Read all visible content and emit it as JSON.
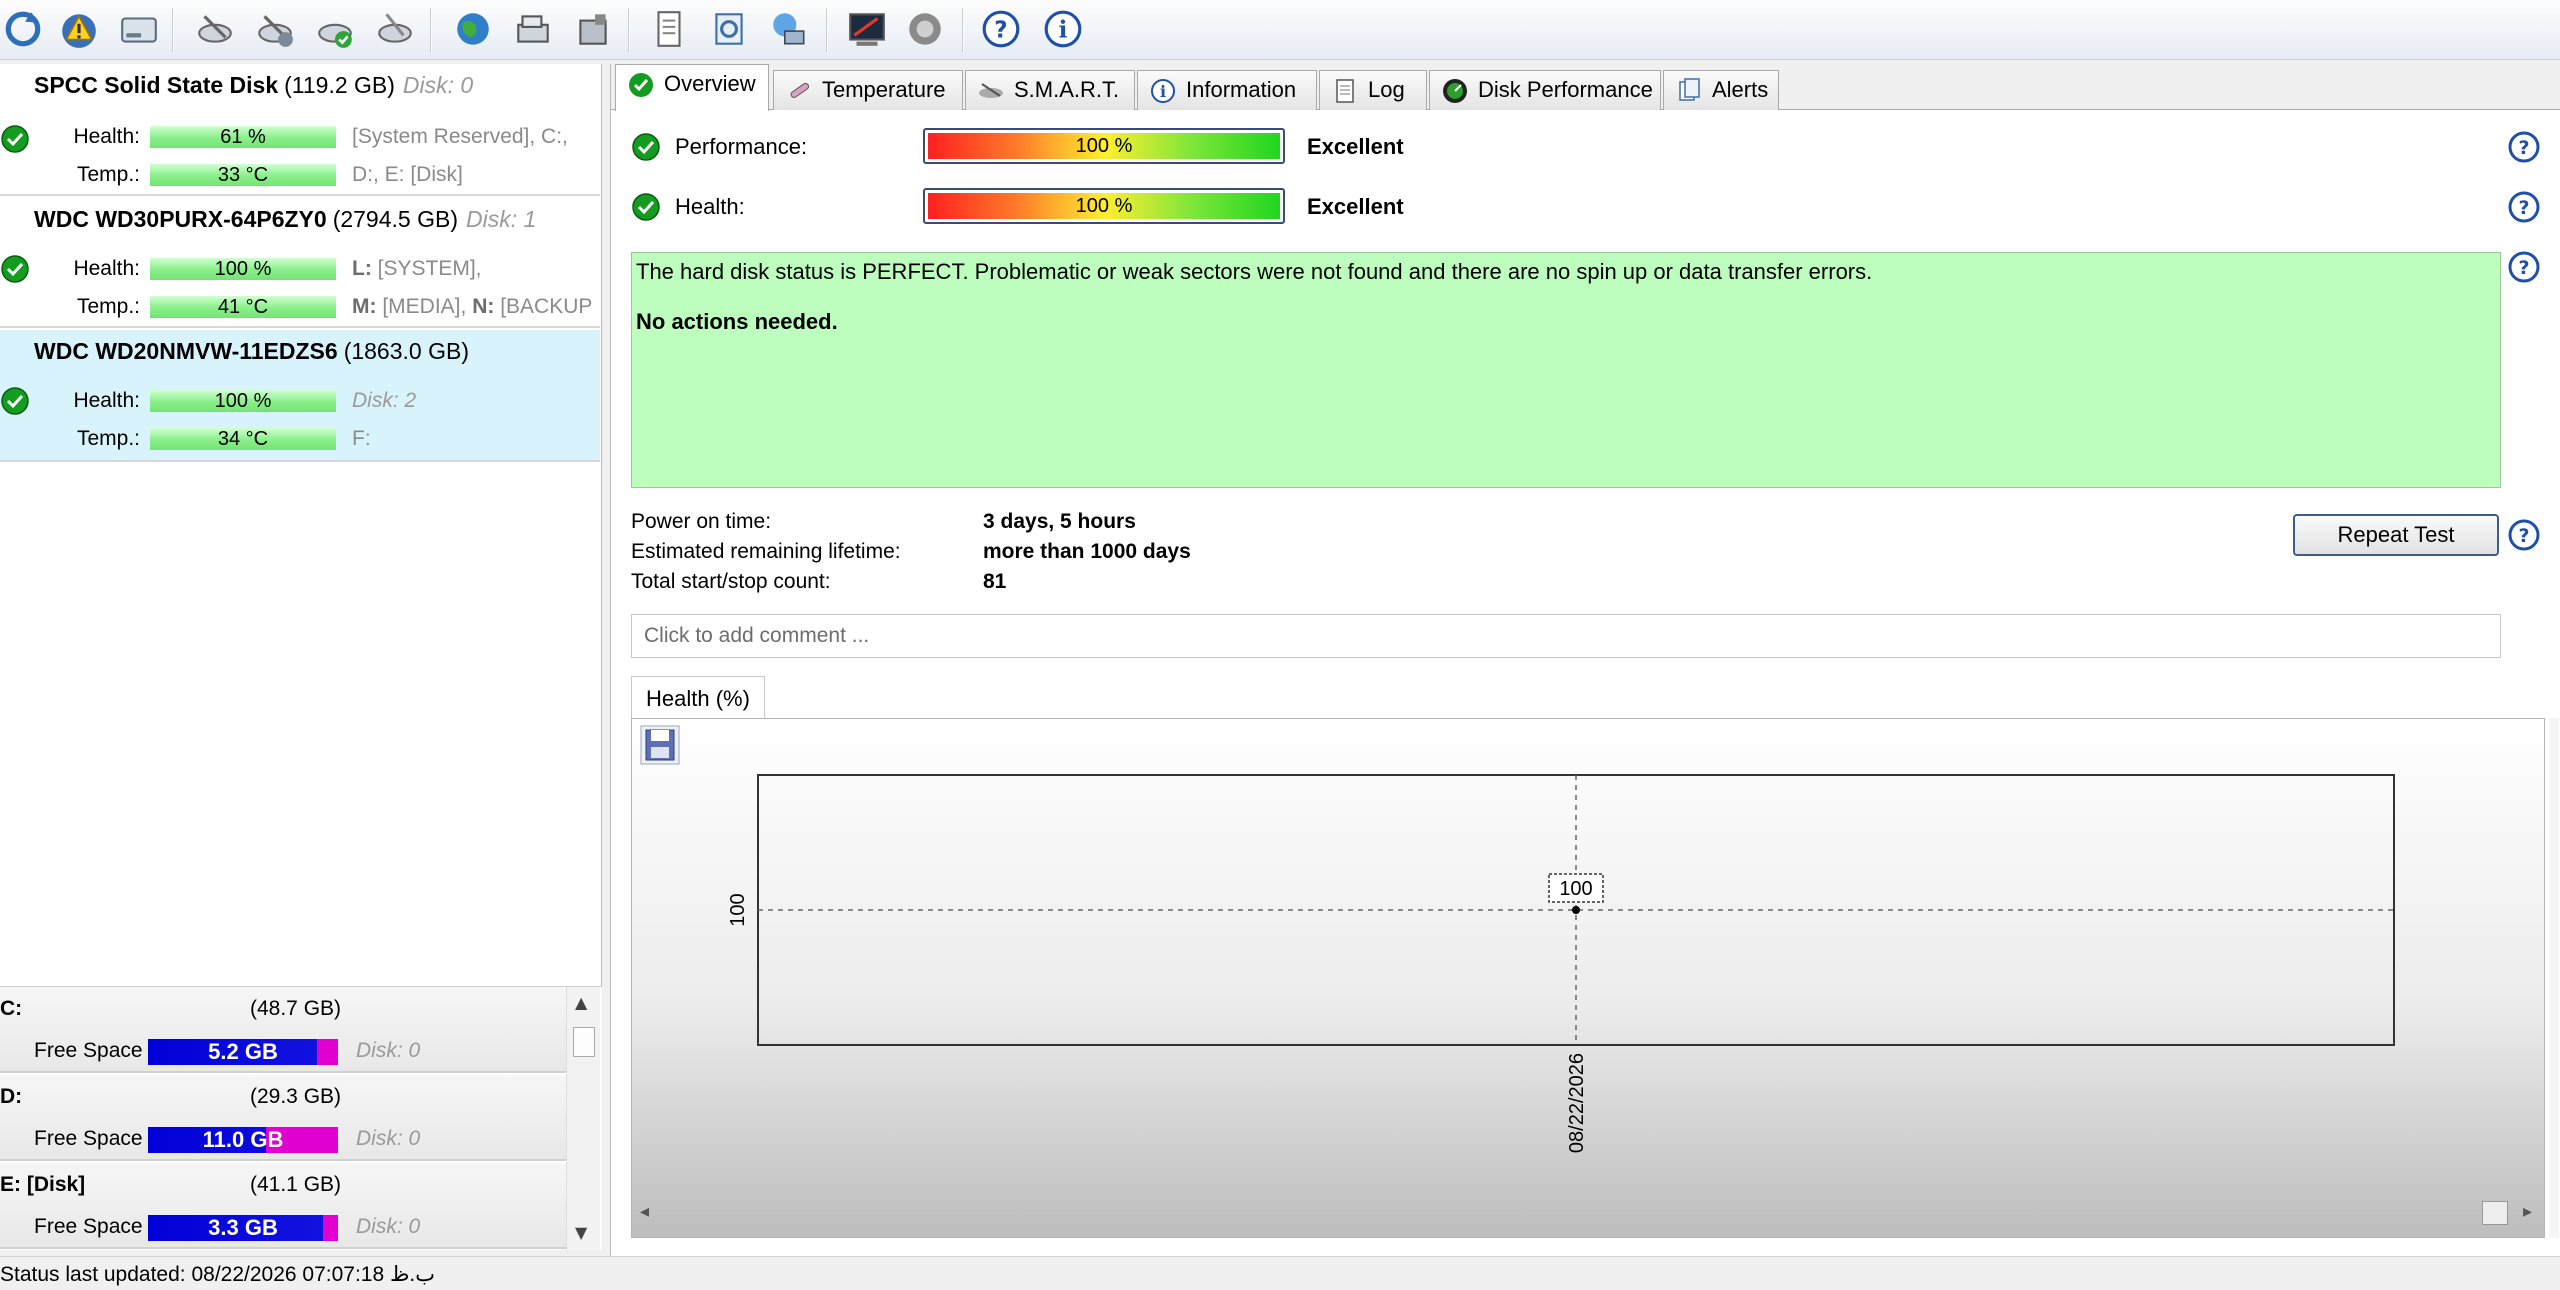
{
  "toolbar": {
    "icons": [
      "refresh-icon",
      "alert-settings-icon",
      "disk-icon",
      "test-disk-icon",
      "extended-test-icon",
      "verify-disk-icon",
      "disk-settings-icon",
      "web-icon",
      "network-icon",
      "server-icon",
      "report-icon",
      "update-icon",
      "network-drive-icon",
      "benchmark-icon",
      "sound-icon",
      "help-icon",
      "about-icon"
    ]
  },
  "disks": [
    {
      "name": "SPCC Solid State Disk",
      "capacity": "(119.2 GB)",
      "disk_no": "Disk: 0",
      "health_label": "Health:",
      "health": "61 %",
      "temp_label": "Temp.:",
      "temp": "33 °C",
      "vols1": "[System Reserved], C:,",
      "vols2": "D:, E: [Disk]"
    },
    {
      "name": "WDC WD30PURX-64P6ZY0",
      "capacity": "(2794.5 GB)",
      "disk_no": "Disk: 1",
      "health_label": "Health:",
      "health": "100 %",
      "temp_label": "Temp.:",
      "temp": "41 °C",
      "vols1_bold": "L:",
      "vols1": " [SYSTEM],",
      "vols2_bold_a": "M:",
      "vols2_a": " [MEDIA], ",
      "vols2_bold_b": "N:",
      "vols2_b": " [BACKUP"
    },
    {
      "name": "WDC WD20NMVW-11EDZS6",
      "capacity": "(1863.0 GB)",
      "health_label": "Health:",
      "health": "100 %",
      "temp_label": "Temp.:",
      "temp": "34 °C",
      "vols1": "Disk: 2",
      "vols2": "F:"
    }
  ],
  "partitions": [
    {
      "name": "C:",
      "size": "(48.7 GB)",
      "free_label": "Free Space",
      "free": "5.2 GB",
      "used_fraction": 0.11,
      "disk": "Disk: 0"
    },
    {
      "name": "D:",
      "size": "(29.3 GB)",
      "free_label": "Free Space",
      "free": "11.0 GB",
      "used_fraction": 0.38,
      "disk": "Disk: 0"
    },
    {
      "name": "E: [Disk]",
      "size": "(41.1 GB)",
      "free_label": "Free Space",
      "free": "3.3 GB",
      "used_fraction": 0.08,
      "disk": "Disk: 0"
    }
  ],
  "tabs": [
    "Overview",
    "Temperature",
    "S.M.A.R.T.",
    "Information",
    "Log",
    "Disk Performance",
    "Alerts"
  ],
  "overview": {
    "performance_label": "Performance:",
    "performance_value": "100 %",
    "performance_verdict": "Excellent",
    "health_label": "Health:",
    "health_value": "100 %",
    "health_verdict": "Excellent",
    "status_text": "The hard disk status is PERFECT. Problematic or weak sectors were not found and there are no spin up or data transfer errors.",
    "action_text": "No actions needed.",
    "power_on_label": "Power on time:",
    "power_on_value": "3 days, 5 hours",
    "lifetime_label": "Estimated remaining lifetime:",
    "lifetime_value": "more than 1000 days",
    "startstop_label": "Total start/stop count:",
    "startstop_value": "81",
    "repeat_button": "Repeat Test",
    "comment_placeholder": "Click to add comment ..."
  },
  "chart_tab": "Health (%)",
  "chart_data": {
    "type": "line",
    "title": "",
    "x": [
      "08/22/2026"
    ],
    "series": [
      {
        "values": [
          100
        ]
      }
    ],
    "xlabel": "",
    "ylabel": "",
    "yticks": [
      "100"
    ],
    "data_labels": [
      "100"
    ]
  },
  "status_bar": "Status last updated: 08/22/2026 07:07:18 ب.ظ"
}
